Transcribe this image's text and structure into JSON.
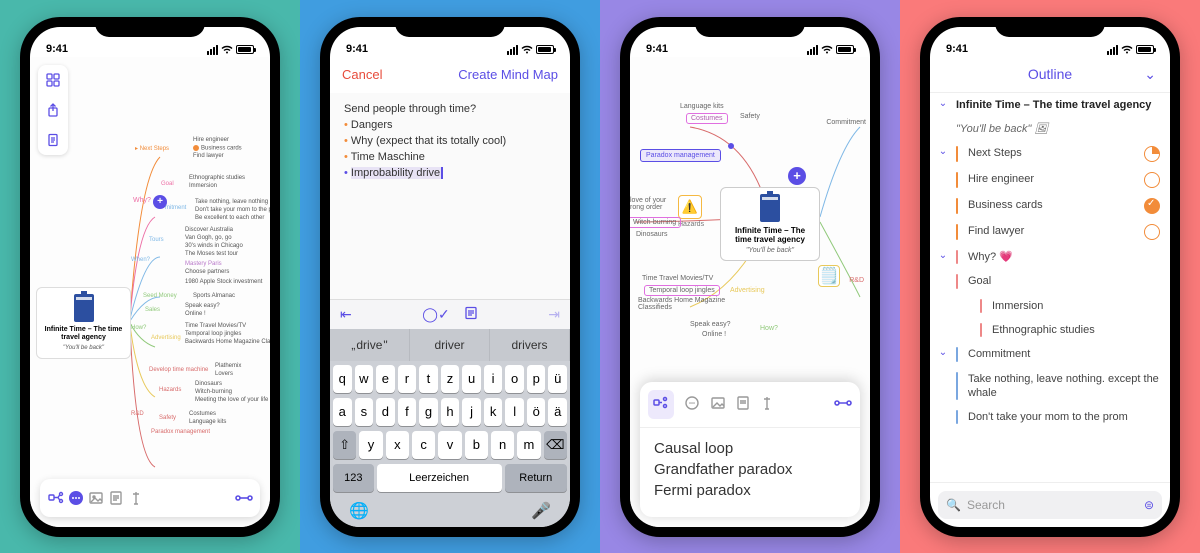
{
  "common": {
    "time": "9:41",
    "central_title": "Infinite Time – The time travel agency",
    "central_sub": "\"You'll be back\""
  },
  "p1": {
    "branches": {
      "next_steps": "Next Steps",
      "next_steps_items": [
        "Hire engineer",
        "Business cards",
        "Find lawyer"
      ],
      "goal": "Goal",
      "goal_items": [
        "Ethnographic studies",
        "Immersion"
      ],
      "why": "Why?",
      "commitment": "mitment",
      "commitment_items": [
        "Take nothing, leave nothing except the whale",
        "Don't take your mom to the prom",
        "Be excellent to each other"
      ],
      "tours": "Tours",
      "tours_items": [
        "Discover Australia",
        "Van Gogh, go, go",
        "30's winds in Chicago",
        "The Moses test tour"
      ],
      "when": "When?",
      "when_items": [
        "Mastery Paris",
        "Choose partners",
        "1980 Apple Stock investment"
      ],
      "seed_money": "Seed Money",
      "seed_items": [
        "Sports Almanac"
      ],
      "sales": "Sales",
      "sales_items": [
        "Speak easy?",
        "Online !"
      ],
      "how": "How?",
      "how_items": [
        "Time Travel Movies/TV",
        "Temporal loop jingles",
        "Backwards Home Magazine Classifieds"
      ],
      "advertising": "Advertising",
      "rd": "R&D",
      "rd_items": [
        "Develop time machine",
        "Hazards",
        "Safety",
        "Paradox management"
      ],
      "dev_items": [
        "Plathemix",
        "Lovers"
      ],
      "haz_items": [
        "Dinosaurs",
        "Witch-burning",
        "Meeting the love of your life in the wrong order"
      ],
      "safety_items": [
        "Costumes",
        "Language kits"
      ]
    }
  },
  "p2": {
    "cancel": "Cancel",
    "create": "Create Mind Map",
    "lines": [
      {
        "text": "Send people through time?",
        "indent": 0,
        "bullet": false
      },
      {
        "text": "Dangers",
        "indent": 1,
        "bullet": true
      },
      {
        "text": "Why (expect that its totally cool)",
        "indent": 1,
        "bullet": true
      },
      {
        "text": "Time Maschine",
        "indent": 1,
        "bullet": true
      }
    ],
    "cursor_line": "Improbability drive",
    "predictions": [
      "drive",
      "driver",
      "drivers"
    ],
    "keys": {
      "r1": [
        "q",
        "w",
        "e",
        "r",
        "t",
        "z",
        "u",
        "i",
        "o",
        "p",
        "ü"
      ],
      "r2": [
        "a",
        "s",
        "d",
        "f",
        "g",
        "h",
        "j",
        "k",
        "l",
        "ö",
        "ä"
      ],
      "r3": [
        "⇧",
        "y",
        "x",
        "c",
        "v",
        "b",
        "n",
        "m",
        "⌫"
      ],
      "num": "123",
      "space": "Leerzeichen",
      "ret": "Return"
    }
  },
  "p3": {
    "nodes": {
      "lang": "Language kits",
      "costumes": "Costumes",
      "safety": "Safety",
      "paradox": "Paradox management",
      "love_order": "love of your\nrong order",
      "witch": "Witch-burning",
      "dino": "Dinosaurs",
      "hazards": "Hazards",
      "movies": "Time Travel Movies/TV",
      "jingles": "Temporal loop jingles",
      "backwards": "Backwards Home Magazine\nClassifieds",
      "advertising": "Advertising",
      "speak": "Speak easy?",
      "online": "Online !",
      "how": "How?",
      "commitment": "Commitment",
      "rd": "R&D"
    },
    "popup_lines": [
      "Causal loop",
      "Grandfather paradox",
      "Fermi paradox"
    ]
  },
  "p4": {
    "title": "Outline",
    "rows": [
      {
        "type": "title",
        "text": "Infinite Time – The time travel agency"
      },
      {
        "type": "subtitle",
        "text": "\"You'll be back\"",
        "icon": "image"
      },
      {
        "type": "section",
        "text": "Next Steps",
        "status": "progress",
        "color": "#f28c3a"
      },
      {
        "type": "item",
        "text": "Hire engineer",
        "status": "empty",
        "color": "#f28c3a"
      },
      {
        "type": "item",
        "text": "Business cards",
        "status": "done",
        "color": "#f28c3a"
      },
      {
        "type": "item",
        "text": "Find lawyer",
        "status": "empty",
        "color": "#f28c3a"
      },
      {
        "type": "section",
        "text": "Why? 💗",
        "color": "#e88"
      },
      {
        "type": "item",
        "text": "Goal",
        "color": "#e88"
      },
      {
        "type": "sub",
        "text": "Immersion",
        "color": "#e88"
      },
      {
        "type": "sub",
        "text": "Ethnographic studies",
        "color": "#e88"
      },
      {
        "type": "section",
        "text": "Commitment",
        "color": "#7aa7e0"
      },
      {
        "type": "item",
        "text": "Take nothing, leave nothing. except the whale",
        "color": "#7aa7e0"
      },
      {
        "type": "item",
        "text": "Don't take your mom to the prom",
        "color": "#7aa7e0"
      }
    ],
    "search": "Search"
  }
}
